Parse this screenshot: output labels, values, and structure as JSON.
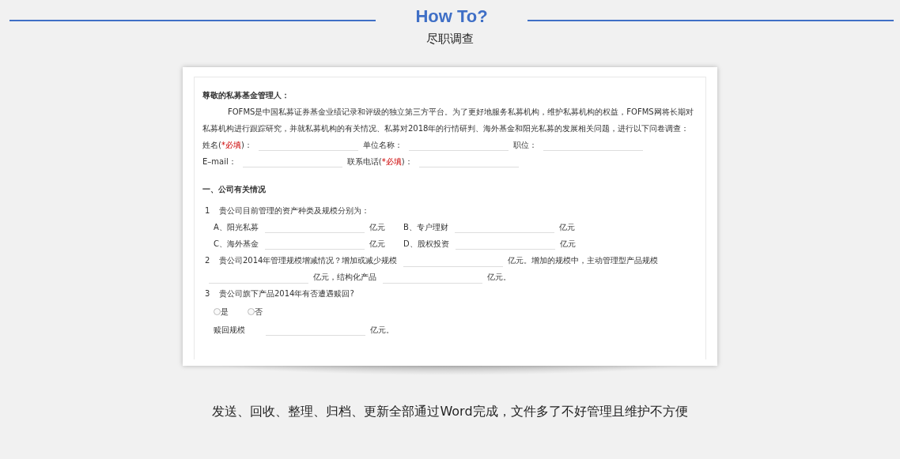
{
  "header": {
    "title": "How To?",
    "subtitle": "尽职调查"
  },
  "letter": {
    "greeting": "尊敬的私募基金管理人：",
    "paragraph": "FOFMS是中国私募证券基金业绩记录和评级的独立第三方平台。为了更好地服务私募机构，维护私募机构的权益，FOFMS网将长期对私募机构进行跟踪研究，并就私募机构的有关情况、私募对2018年的行情研判、海外基金和阳光私募的发展相关问题，进行以下问卷调查："
  },
  "field_rows": [
    [
      {
        "label": "姓名(",
        "required": "*必填",
        "label_end": ")："
      },
      {
        "label": "单位名称："
      },
      {
        "label": "职位："
      }
    ],
    [
      {
        "label": "E–mail："
      },
      {
        "label": "联系电话(",
        "required": "*必填",
        "label_end": ")："
      }
    ]
  ],
  "section_title": "一、公司有关情况",
  "questions": [
    {
      "kind": "options",
      "number": "1",
      "text": "贵公司目前管理的资产种类及规模分别为：",
      "options": [
        {
          "label": "A、阳光私募",
          "unit": "亿元"
        },
        {
          "label": "B、专户理财",
          "unit": "亿元"
        },
        {
          "label": "C、海外基金",
          "unit": "亿元"
        },
        {
          "label": "D、股权投资",
          "unit": "亿元"
        }
      ]
    },
    {
      "kind": "inline",
      "number": "2",
      "parts": [
        {
          "kind": "text",
          "text": "贵公司2014年管理规模增减情况？增加或减少规模"
        },
        {
          "kind": "blank"
        },
        {
          "kind": "text",
          "text": "亿元。增加的规模中，主动管理型产品规模"
        },
        {
          "kind": "blank"
        },
        {
          "kind": "text",
          "text": "亿元，结构化产品"
        },
        {
          "kind": "blank"
        },
        {
          "kind": "text",
          "text": "亿元。"
        }
      ]
    },
    {
      "kind": "radio",
      "number": "3",
      "text": "贵公司旗下产品2014年有否遭遇赎回?",
      "radios": [
        {
          "label": "是",
          "selected": false
        },
        {
          "label": "否",
          "selected": false
        }
      ],
      "followup": {
        "label": "赎回规模",
        "unit": "亿元。"
      }
    }
  ],
  "caption": "发送、回收、整理、归档、更新全部通过Word完成，文件多了不好管理且维护不方便"
}
